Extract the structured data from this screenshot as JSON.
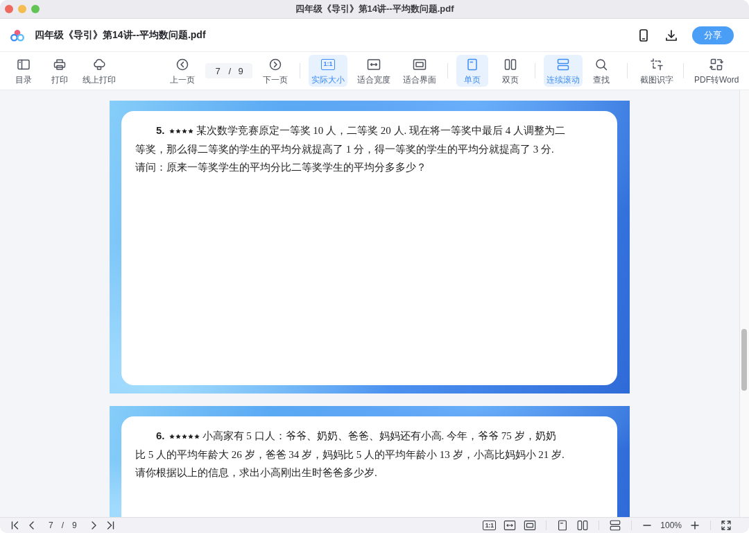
{
  "window": {
    "title": "四年级《导引》第14讲--平均数问题.pdf"
  },
  "header": {
    "file_name": "四年级《导引》第14讲--平均数问题.pdf",
    "share_button": "分享"
  },
  "toolbar": {
    "file_tools": [
      {
        "label": "目录"
      },
      {
        "label": "打印"
      },
      {
        "label": "线上打印"
      }
    ],
    "previous_page": "上一页",
    "page_field": {
      "value": "7",
      "separator": "/",
      "total": "9"
    },
    "next_page": "下一页",
    "zoom_modes": [
      {
        "label": "实际大小",
        "mark": "1:1",
        "selected": true
      },
      {
        "label": "适合宽度",
        "selected": false
      },
      {
        "label": "适合界面",
        "selected": false
      }
    ],
    "page_modes": [
      {
        "label": "单页",
        "selected": true
      },
      {
        "label": "双页",
        "selected": false
      }
    ],
    "continuous_scroll": {
      "label": "连续滚动",
      "on": true
    },
    "find": "查找",
    "screenshot_ocr": "截图识字",
    "convert": "PDF转Word"
  },
  "document": {
    "problems": [
      {
        "number": "5.",
        "stars": 4,
        "text": "某次数学竞赛原定一等奖 10 人，二等奖 20 人. 现在将一等奖中最后 4 人调整为二等奖，那么得二等奖的学生的平均分就提高了 1 分，得一等奖的学生的平均分就提高了 3 分. 请问：原来一等奖学生的平均分比二等奖学生的平均分多多少？"
      },
      {
        "number": "6.",
        "stars": 5,
        "text": "小高家有 5 口人：爷爷、奶奶、爸爸、妈妈还有小高. 今年，爷爷 75 岁，奶奶比 5 人的平均年龄大 26 岁，爸爸 34 岁，妈妈比 5 人的平均年龄小 13 岁，小高比妈妈小 21 岁. 请你根据以上的信息，求出小高刚出生时爸爸多少岁."
      }
    ]
  },
  "status_bar": {
    "current_page": "7",
    "separator": "/",
    "total_pages": "9",
    "actual_size_mark": "1:1",
    "zoom": "100%"
  }
}
